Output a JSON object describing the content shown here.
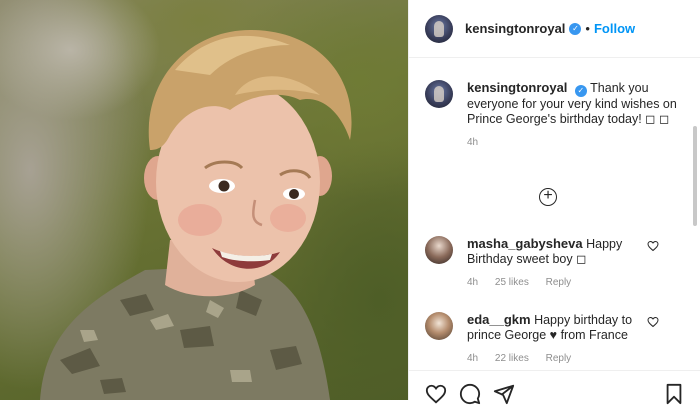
{
  "post": {
    "author": "kensingtonroyal",
    "verified_mark": "✓",
    "dot": "•",
    "follow_label": "Follow"
  },
  "caption": {
    "author": "kensingtonroyal",
    "text": "Thank you everyone for your very kind wishes on Prince George's birthday today! ◻ ◻",
    "time": "4h"
  },
  "more_comments_icon": "⊕",
  "comments": [
    {
      "author": "masha_gabysheva",
      "text": "Happy Birthday sweet boy ◻",
      "time": "4h",
      "likes": "25 likes",
      "reply": "Reply"
    },
    {
      "author": "eda__gkm",
      "text": "Happy birthday to prince George ♥ from France",
      "time": "4h",
      "likes": "22 likes",
      "reply": "Reply"
    }
  ],
  "icons": {
    "heart": "heart-outline-icon",
    "comment": "comment-icon",
    "share": "paper-plane-icon",
    "save": "bookmark-icon",
    "add_comment": "plus-circle-icon",
    "verified": "verified-badge-icon"
  },
  "colors": {
    "accent": "#0095f6",
    "verified": "#3897f0",
    "muted": "#8e8e8e",
    "text": "#262626"
  }
}
